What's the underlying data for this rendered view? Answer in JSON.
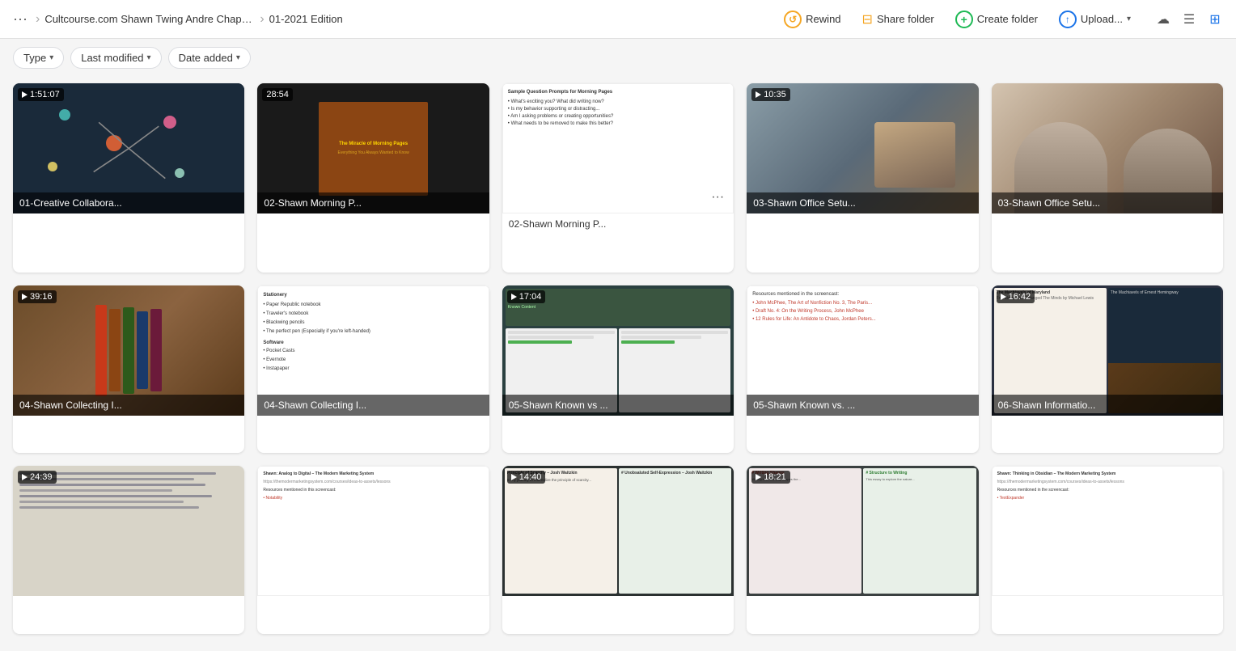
{
  "topbar": {
    "dots_label": "···",
    "breadcrumb1": "Cultcourse.com Shawn Twing Andre Chaperon - Id...",
    "breadcrumb2": "01-2021 Edition",
    "rewind_label": "Rewind",
    "share_label": "Share folder",
    "create_label": "Create folder",
    "upload_label": "Upload...",
    "cloud_icon": "☁",
    "list_icon": "☰",
    "grid_icon": "⊞"
  },
  "filters": {
    "type_label": "Type",
    "lastmod_label": "Last modified",
    "dateadded_label": "Date added"
  },
  "cards": [
    {
      "id": "card-1",
      "duration": "1:51:07",
      "has_play": true,
      "label": "01-Creative Collabora...",
      "bg": "mind-map-bg"
    },
    {
      "id": "card-2",
      "duration": "28:54",
      "has_play": false,
      "label": "02-Shawn Morning P...",
      "bg": "book-cover-bg"
    },
    {
      "id": "card-3",
      "duration": "",
      "has_play": false,
      "label": "02-Shawn Morning P...",
      "bg": "doc-bg",
      "has_more": true
    },
    {
      "id": "card-4",
      "duration": "10:35",
      "has_play": true,
      "label": "03-Shawn Office Setu...",
      "bg": "office-bg"
    },
    {
      "id": "card-5",
      "duration": "",
      "has_play": false,
      "label": "03-Shawn Office Setu...",
      "bg": "person-bg"
    },
    {
      "id": "card-6",
      "duration": "39:16",
      "has_play": true,
      "label": "04-Shawn Collecting I...",
      "bg": "notebook-bg"
    },
    {
      "id": "card-7",
      "duration": "",
      "has_play": false,
      "label": "04-Shawn Collecting I...",
      "bg": "list-doc-bg"
    },
    {
      "id": "card-8",
      "duration": "17:04",
      "has_play": true,
      "label": "05-Shawn Known vs ...",
      "bg": "split-screen-bg"
    },
    {
      "id": "card-9",
      "duration": "",
      "has_play": false,
      "label": "05-Shawn Known vs. ...",
      "bg": "doc-list-red-bg"
    },
    {
      "id": "card-10",
      "duration": "16:42",
      "has_play": true,
      "label": "06-Shawn Informatio...",
      "bg": "book-split-bg"
    },
    {
      "id": "card-11",
      "duration": "24:39",
      "has_play": true,
      "label": "",
      "bg": "handwriting-bg"
    },
    {
      "id": "card-12",
      "duration": "",
      "has_play": false,
      "label": "",
      "bg": "analog-digital-bg"
    },
    {
      "id": "card-13",
      "duration": "14:40",
      "has_play": true,
      "label": "",
      "bg": "scarcity-bg"
    },
    {
      "id": "card-14",
      "duration": "18:21",
      "has_play": true,
      "label": "",
      "bg": "writing-shapes-bg"
    },
    {
      "id": "card-15",
      "duration": "",
      "has_play": false,
      "label": "",
      "bg": "obsidian-bg"
    }
  ]
}
